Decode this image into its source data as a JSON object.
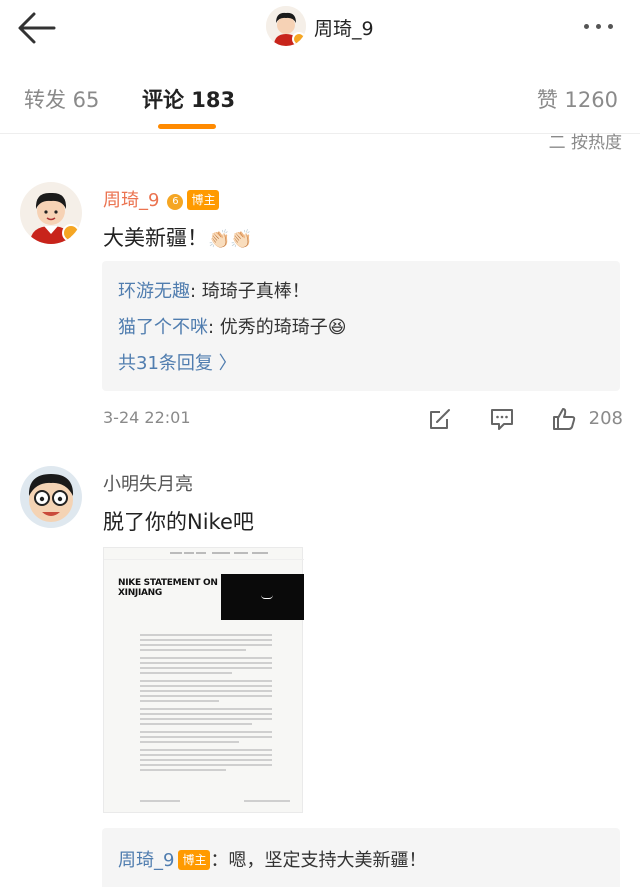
{
  "topbar": {
    "title": "周琦_9",
    "back_icon": "arrow-left-icon",
    "more_icon": "more-dots-icon"
  },
  "tabs": {
    "repost": "转发 65",
    "comments": "评论 183",
    "likes": "赞 1260",
    "sort": "二 按热度"
  },
  "colors": {
    "accent": "#ff8a00",
    "username_highlight": "#eb7350",
    "link_blue": "#507daf",
    "reply_bg": "#f5f5f5"
  },
  "comment1": {
    "username": "周琦_9",
    "level": "6",
    "badge": "博主",
    "text": "大美新疆！",
    "emoji": "👏🏻👏🏻",
    "replies": [
      {
        "user": "环游无趣",
        "text": ": 琦琦子真棒！",
        "emoji": ""
      },
      {
        "user": "猫了个不咪",
        "text": ": 优秀的琦琦子",
        "emoji": "😆"
      }
    ],
    "more_replies": "共31条回复 〉",
    "time": "3-24 22:01",
    "likes": "208"
  },
  "comment2": {
    "username": "小明失月亮",
    "text": "脱了你的Nike吧",
    "image_title": "NIKE STATEMENT ON XINJIANG",
    "reply": {
      "user": "周琦_9",
      "badge": "博主",
      "text": "：嗯，坚定支持大美新疆！"
    }
  }
}
